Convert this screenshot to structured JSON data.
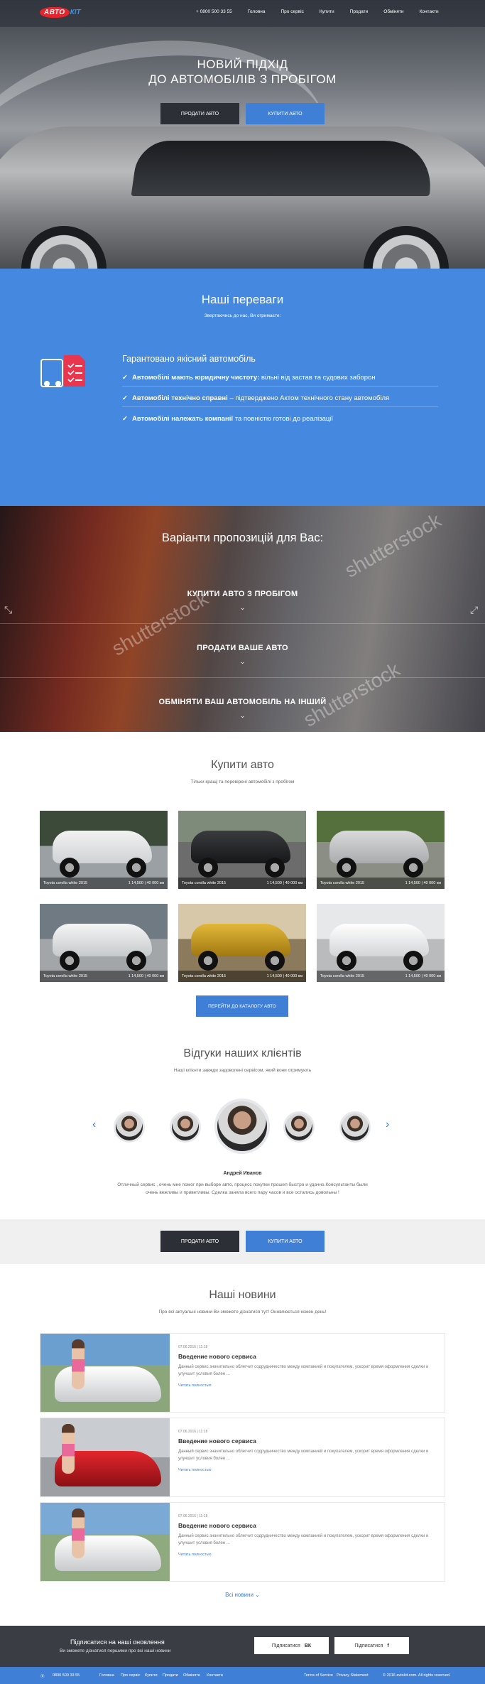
{
  "header": {
    "logo_text": "АВТО",
    "logo_suffix": "КІТ",
    "phone": "+ 0800 500 33 55",
    "nav": [
      "Головна",
      "Про сервіс",
      "Купити",
      "Продати",
      "Обміняти",
      "Контакти"
    ]
  },
  "hero": {
    "title_line1": "НОВИЙ ПІДХІД",
    "title_line2": "ДО АВТОМОБІЛІВ З ПРОБІГОМ",
    "sell_button": "ПРОДАТИ АВТО",
    "buy_button": "КУПИТИ АВТО"
  },
  "advantages": {
    "title": "Наші переваги",
    "subtitle": "Звертаючись до нас, Ви отримаєте:",
    "lead": "Гарантовано якісний автомобіль",
    "items": [
      {
        "bold": "Автомобілі мають юридичну чистоту:",
        "rest": " вільні від застав та судових заборон"
      },
      {
        "bold": "Автомобілі технічно справні",
        "rest": " – підтверджено Актом технічного стану автомобіля"
      },
      {
        "bold": "Автомобілі належать компанії",
        "rest": " та повністю готові до реалізації"
      }
    ]
  },
  "offers": {
    "title": "Варіанти пропозицій для Вас:",
    "items": [
      "КУПИТИ АВТО З ПРОБІГОМ",
      "ПРОДАТИ ВАШЕ АВТО",
      "ОБМІНЯТИ ВАШ АВТОМОБІЛЬ НА ІНШИЙ"
    ],
    "chevron": "⌄",
    "watermark": "shutterstock"
  },
  "buy": {
    "title": "Купити авто",
    "subtitle": "Тільки кращі та перевірені автомобілі з пробігом",
    "cars": [
      {
        "name": "Toyota corolla white 2015",
        "info": "1 14,500 | 40 000 км"
      },
      {
        "name": "Toyota corolla white 2015",
        "info": "1 14,500 | 40 000 км"
      },
      {
        "name": "Toyota corolla white 2015",
        "info": "1 14,500 | 40 000 км"
      },
      {
        "name": "Toyota corolla white 2015",
        "info": "1 14,500 | 40 000 км"
      },
      {
        "name": "Toyota corolla white 2015",
        "info": "1 14,500 | 40 000 км"
      },
      {
        "name": "Toyota corolla white 2015",
        "info": "1 14,500 | 40 000 км"
      }
    ],
    "catalog_button": "ПЕРЕЙТИ ДО КАТАЛОГУ АВТО"
  },
  "reviews": {
    "title": "Відгуки наших клієнтів",
    "subtitle": "Наші клієнти завжди задоволені сервісом, який вони отримують",
    "name": "Андрей Иванов",
    "text_line1": "Отличный сервис , очень мне помог при выборе авто, процесс покупки прошел быстро и удачно.Консультанты были",
    "text_line2": "очень вежливы и приветливы. Сделка заняла всего пару часов и все остались довольны !",
    "prev": "‹",
    "next": "›"
  },
  "cta": {
    "sell_button": "ПРОДАТИ АВТО",
    "buy_button": "КУПИТИ АВТО"
  },
  "news": {
    "title": "Наші новини",
    "subtitle": "Про всі актуальні новини Ви зможете дізнатися тут! Оновлюється кожен день!",
    "items": [
      {
        "date": "07.06.2016 | 11:18",
        "title": "Введение нового сервиса",
        "text": "Данный сервис значительно облегчит содрудничество между компанией и покупателем, ускорит время оформления сделки и улучшит условия более ...",
        "more": "Читать полностью"
      },
      {
        "date": "07.06.2016 | 11:18",
        "title": "Введение нового сервиса",
        "text": "Данный сервис значительно облегчит содрудничество между компанией и покупателем, ускорит время оформления сделки и улучшит условия более ...",
        "more": "Читать полностью"
      },
      {
        "date": "07.06.2016 | 11:18",
        "title": "Введение нового сервиса",
        "text": "Данный сервис значительно облегчит содрудничество между компанией и покупателем, ускорит время оформления сделки и улучшит условия более ...",
        "more": "Читать полностью"
      }
    ],
    "all_link": "Всі новини ⌄"
  },
  "subscribe": {
    "title": "Підписатися на наші оновлення",
    "text": "Ви зможете дізнатися першими про всі наші новини",
    "vk_button": "Підписатися",
    "vk_icon_text": "ВК",
    "fb_button": "Підписатися",
    "fb_icon_text": "f"
  },
  "footer": {
    "phone": "0800 500 33 55",
    "nav": [
      "Головна",
      "Про сервіс",
      "Купити",
      "Продати",
      "Обміняти",
      "Контакти"
    ],
    "terms": "Terms of Service",
    "privacy": "Privacy Statement",
    "copyright": "© 2016 avtokit.com. All rights reserved."
  }
}
